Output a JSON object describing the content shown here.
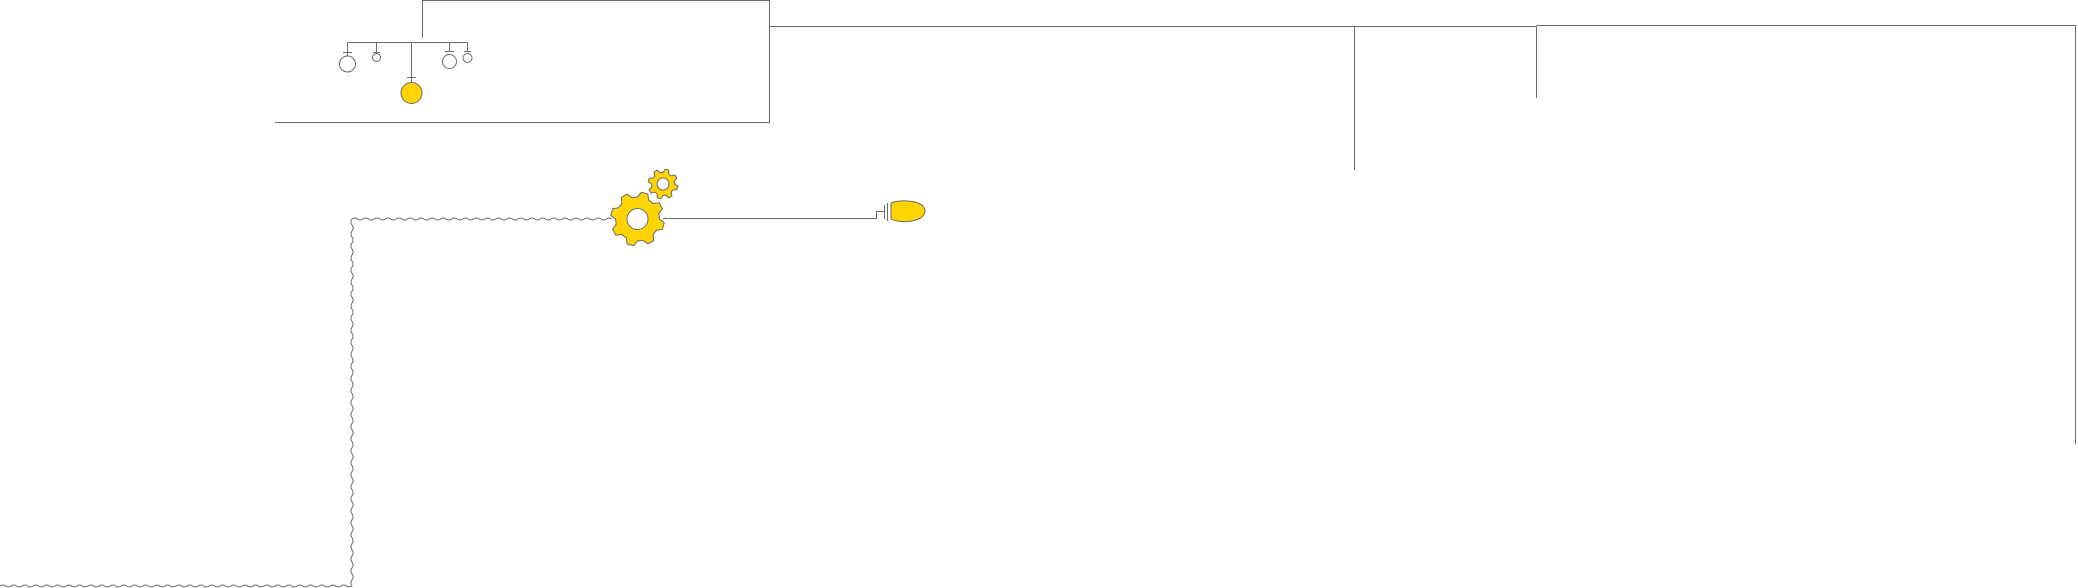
{
  "diagram": {
    "elements": {
      "top_frame": "frame",
      "tree": {
        "root": "tree-root",
        "leaves": [
          {
            "name": "leaf-1",
            "highlighted": false
          },
          {
            "name": "leaf-2",
            "highlighted": false
          },
          {
            "name": "leaf-3",
            "highlighted": true
          },
          {
            "name": "leaf-4",
            "highlighted": false
          },
          {
            "name": "leaf-5",
            "highlighted": false
          }
        ]
      },
      "connectors": [
        "wavy-connector",
        "straight-connector"
      ],
      "gears": [
        "large-gear",
        "small-gear"
      ],
      "terminal": "plug"
    },
    "colors": {
      "line": "#6b6b6b",
      "accent": "#ffd400",
      "background": "#ffffff"
    },
    "icons": [
      "gear-icon",
      "gear-icon",
      "plug-icon"
    ]
  }
}
